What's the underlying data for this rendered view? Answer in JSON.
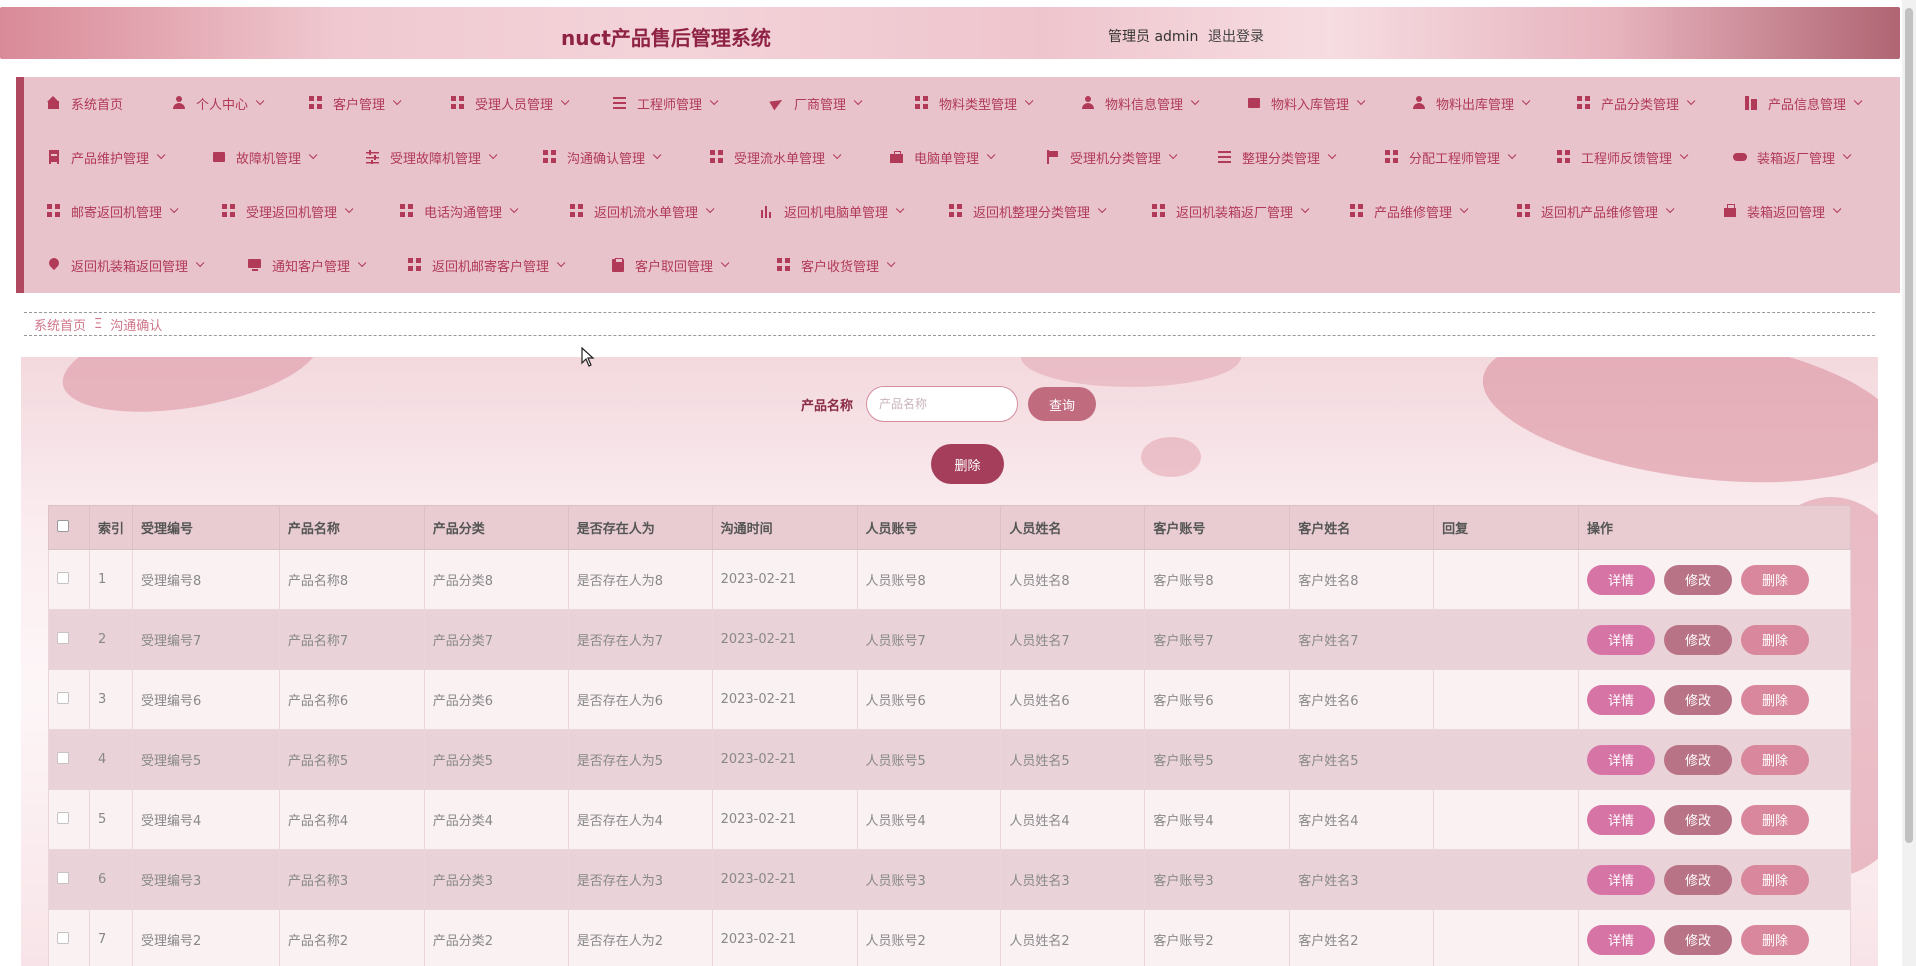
{
  "header": {
    "title": "nuct产品售后管理系统",
    "role": "管理员",
    "username": "admin",
    "logout": "退出登录"
  },
  "nav": {
    "items": [
      {
        "label": "系统首页",
        "icon": "home-icon",
        "caret": false
      },
      {
        "label": "个人中心",
        "icon": "user-icon",
        "caret": true
      },
      {
        "label": "客户管理",
        "icon": "grid-icon",
        "caret": true
      },
      {
        "label": "受理人员管理",
        "icon": "grid-icon",
        "caret": true
      },
      {
        "label": "工程师管理",
        "icon": "list-icon",
        "caret": true
      },
      {
        "label": "厂商管理",
        "icon": "paper-plane-icon",
        "caret": true
      },
      {
        "label": "物料类型管理",
        "icon": "grid-icon",
        "caret": true
      },
      {
        "label": "物料信息管理",
        "icon": "user-icon",
        "caret": true
      },
      {
        "label": "物料入库管理",
        "icon": "printer-icon",
        "caret": true
      },
      {
        "label": "物料出库管理",
        "icon": "user-icon",
        "caret": true
      },
      {
        "label": "产品分类管理",
        "icon": "grid-icon",
        "caret": true
      },
      {
        "label": "产品信息管理",
        "icon": "books-icon",
        "caret": true
      },
      {
        "label": "产品维护管理",
        "icon": "document-icon",
        "caret": true
      },
      {
        "label": "故障机管理",
        "icon": "calendar-x-icon",
        "caret": true
      },
      {
        "label": "受理故障机管理",
        "icon": "sliders-icon",
        "caret": true
      },
      {
        "label": "沟通确认管理",
        "icon": "grid-icon",
        "caret": true
      },
      {
        "label": "受理流水单管理",
        "icon": "grid-icon",
        "caret": true
      },
      {
        "label": "电脑单管理",
        "icon": "briefcase-icon",
        "caret": true
      },
      {
        "label": "受理机分类管理",
        "icon": "flag-icon",
        "caret": true
      },
      {
        "label": "整理分类管理",
        "icon": "list-icon",
        "caret": true
      },
      {
        "label": "分配工程师管理",
        "icon": "grid-icon",
        "caret": true
      },
      {
        "label": "工程师反馈管理",
        "icon": "grid-icon",
        "caret": true
      },
      {
        "label": "装箱返厂管理",
        "icon": "gamepad-icon",
        "caret": true
      },
      {
        "label": "邮寄返回机管理",
        "icon": "grid-icon",
        "caret": true
      },
      {
        "label": "受理返回机管理",
        "icon": "grid-icon",
        "caret": true
      },
      {
        "label": "电话沟通管理",
        "icon": "grid-icon",
        "caret": true
      },
      {
        "label": "返回机流水单管理",
        "icon": "grid-icon",
        "caret": true
      },
      {
        "label": "返回机电脑单管理",
        "icon": "bar-chart-icon",
        "caret": true
      },
      {
        "label": "返回机整理分类管理",
        "icon": "grid-icon",
        "caret": true
      },
      {
        "label": "返回机装箱返厂管理",
        "icon": "grid-icon",
        "caret": true
      },
      {
        "label": "产品维修管理",
        "icon": "grid-icon",
        "caret": true
      },
      {
        "label": "返回机产品维修管理",
        "icon": "grid-icon",
        "caret": true
      },
      {
        "label": "装箱返回管理",
        "icon": "bag-icon",
        "caret": true
      },
      {
        "label": "返回机装箱返回管理",
        "icon": "map-pin-icon",
        "caret": true
      },
      {
        "label": "通知客户管理",
        "icon": "monitor-icon",
        "caret": true
      },
      {
        "label": "返回机邮寄客户管理",
        "icon": "grid-icon",
        "caret": true
      },
      {
        "label": "客户取回管理",
        "icon": "clipboard-icon",
        "caret": true
      },
      {
        "label": "客户收货管理",
        "icon": "grid-icon",
        "caret": true
      }
    ]
  },
  "breadcrumb": {
    "home": "系统首页",
    "separator": "Ξ",
    "current": "沟通确认"
  },
  "search": {
    "label": "产品名称",
    "placeholder": "产品名称",
    "value": "",
    "query_button": "查询",
    "delete_button": "删除"
  },
  "table": {
    "columns": [
      "",
      "索引",
      "受理编号",
      "产品名称",
      "产品分类",
      "是否存在人为",
      "沟通时间",
      "人员账号",
      "人员姓名",
      "客户账号",
      "客户姓名",
      "回复",
      "操作"
    ],
    "rows": [
      {
        "index": "1",
        "accept_no": "受理编号8",
        "product_name": "产品名称8",
        "product_cat": "产品分类8",
        "human": "是否存在人为8",
        "time": "2023-02-21",
        "staff_acct": "人员账号8",
        "staff_name": "人员姓名8",
        "cust_acct": "客户账号8",
        "cust_name": "客户姓名8",
        "reply": ""
      },
      {
        "index": "2",
        "accept_no": "受理编号7",
        "product_name": "产品名称7",
        "product_cat": "产品分类7",
        "human": "是否存在人为7",
        "time": "2023-02-21",
        "staff_acct": "人员账号7",
        "staff_name": "人员姓名7",
        "cust_acct": "客户账号7",
        "cust_name": "客户姓名7",
        "reply": ""
      },
      {
        "index": "3",
        "accept_no": "受理编号6",
        "product_name": "产品名称6",
        "product_cat": "产品分类6",
        "human": "是否存在人为6",
        "time": "2023-02-21",
        "staff_acct": "人员账号6",
        "staff_name": "人员姓名6",
        "cust_acct": "客户账号6",
        "cust_name": "客户姓名6",
        "reply": ""
      },
      {
        "index": "4",
        "accept_no": "受理编号5",
        "product_name": "产品名称5",
        "product_cat": "产品分类5",
        "human": "是否存在人为5",
        "time": "2023-02-21",
        "staff_acct": "人员账号5",
        "staff_name": "人员姓名5",
        "cust_acct": "客户账号5",
        "cust_name": "客户姓名5",
        "reply": ""
      },
      {
        "index": "5",
        "accept_no": "受理编号4",
        "product_name": "产品名称4",
        "product_cat": "产品分类4",
        "human": "是否存在人为4",
        "time": "2023-02-21",
        "staff_acct": "人员账号4",
        "staff_name": "人员姓名4",
        "cust_acct": "客户账号4",
        "cust_name": "客户姓名4",
        "reply": ""
      },
      {
        "index": "6",
        "accept_no": "受理编号3",
        "product_name": "产品名称3",
        "product_cat": "产品分类3",
        "human": "是否存在人为3",
        "time": "2023-02-21",
        "staff_acct": "人员账号3",
        "staff_name": "人员姓名3",
        "cust_acct": "客户账号3",
        "cust_name": "客户姓名3",
        "reply": ""
      },
      {
        "index": "7",
        "accept_no": "受理编号2",
        "product_name": "产品名称2",
        "product_cat": "产品分类2",
        "human": "是否存在人为2",
        "time": "2023-02-21",
        "staff_acct": "人员账号2",
        "staff_name": "人员姓名2",
        "cust_acct": "客户账号2",
        "cust_name": "客户姓名2",
        "reply": ""
      }
    ],
    "actions": {
      "detail": "详情",
      "edit": "修改",
      "delete": "删除"
    }
  },
  "colors": {
    "accent": "#b03a58",
    "title": "#8f2346",
    "nav_bg": "#e9c3cb",
    "detail_button": "#d774a6",
    "edit_button": "#b97386",
    "delete_button": "#d9879c",
    "query_button": "#c06b7e",
    "batch_delete_button": "#a53e5b"
  }
}
